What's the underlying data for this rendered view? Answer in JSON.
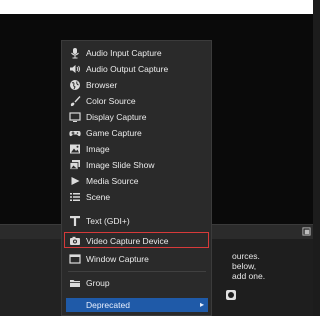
{
  "sources_menu": {
    "items": [
      {
        "label": "Audio Input Capture",
        "icon": "microphone-icon"
      },
      {
        "label": "Audio Output Capture",
        "icon": "speaker-icon"
      },
      {
        "label": "Browser",
        "icon": "globe-icon"
      },
      {
        "label": "Color Source",
        "icon": "brush-icon"
      },
      {
        "label": "Display Capture",
        "icon": "monitor-icon"
      },
      {
        "label": "Game Capture",
        "icon": "gamepad-icon"
      },
      {
        "label": "Image",
        "icon": "image-icon"
      },
      {
        "label": "Image Slide Show",
        "icon": "slideshow-icon"
      },
      {
        "label": "Media Source",
        "icon": "play-icon"
      },
      {
        "label": "Scene",
        "icon": "list-icon"
      },
      {
        "label": "Text (GDI+)",
        "icon": "text-icon"
      },
      {
        "label": "Video Capture Device",
        "icon": "camera-icon",
        "highlighted": true
      },
      {
        "label": "Window Capture",
        "icon": "window-icon"
      },
      {
        "label": "Group",
        "icon": "folder-icon"
      }
    ],
    "deprecated": {
      "label": "Deprecated",
      "arrow": "▸"
    }
  },
  "sources_hint": {
    "text": "ources.\nbelow,\nadd one."
  },
  "colors": {
    "menu_bg": "#2a2a2a",
    "highlight_border": "#d63a3a",
    "selected_bg": "#1f5aa8"
  }
}
